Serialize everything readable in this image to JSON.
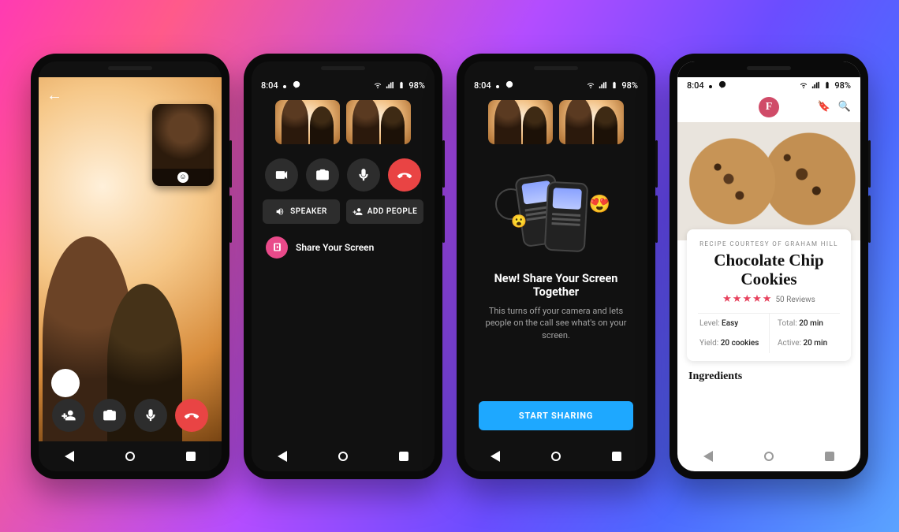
{
  "status": {
    "time": "8:04",
    "battery": "98%"
  },
  "call": {
    "buttons": {
      "add_person": "Add person",
      "switch_camera": "Switch camera",
      "mute": "Mute",
      "end": "End call"
    }
  },
  "controls": {
    "speaker": "SPEAKER",
    "add_people": "ADD PEOPLE",
    "share_screen": "Share Your Screen"
  },
  "promo": {
    "title": "New! Share Your Screen Together",
    "subtitle": "This turns off your camera and lets people on the call see what's on your screen.",
    "cta": "START SHARING"
  },
  "recipe": {
    "brand_initial": "F",
    "kicker": "RECIPE COURTESY OF GRAHAM HILL",
    "title": "Chocolate Chip Cookies",
    "reviews_label": "50 Reviews",
    "meta": {
      "level_k": "Level:",
      "level_v": "Easy",
      "total_k": "Total:",
      "total_v": "20 min",
      "yield_k": "Yield:",
      "yield_v": "20 cookies",
      "active_k": "Active:",
      "active_v": "20 min"
    },
    "section": "Ingredients"
  }
}
